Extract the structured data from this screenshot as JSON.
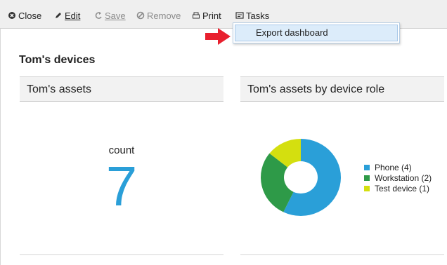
{
  "toolbar": {
    "close": "Close",
    "edit": "Edit",
    "save": "Save",
    "remove": "Remove",
    "print": "Print",
    "tasks": "Tasks"
  },
  "menu": {
    "items": [
      {
        "label": "Export dashboard"
      }
    ]
  },
  "page": {
    "title": "Tom's devices"
  },
  "panels": [
    {
      "title": "Tom's assets",
      "metric": {
        "label": "count",
        "value": "7"
      }
    },
    {
      "title": "Tom's assets by device role"
    }
  ],
  "colors": {
    "accent": "#2a9fd8",
    "phone": "#2a9fd8",
    "workstation": "#2e9a48",
    "test_device": "#d4df0f",
    "arrow": "#e8202e"
  },
  "chart_data": {
    "type": "pie",
    "series": [
      {
        "name": "Phone (4)",
        "value": 4
      },
      {
        "name": "Workstation (2)",
        "value": 2
      },
      {
        "name": "Test device (1)",
        "value": 1
      }
    ],
    "legend": "right"
  }
}
